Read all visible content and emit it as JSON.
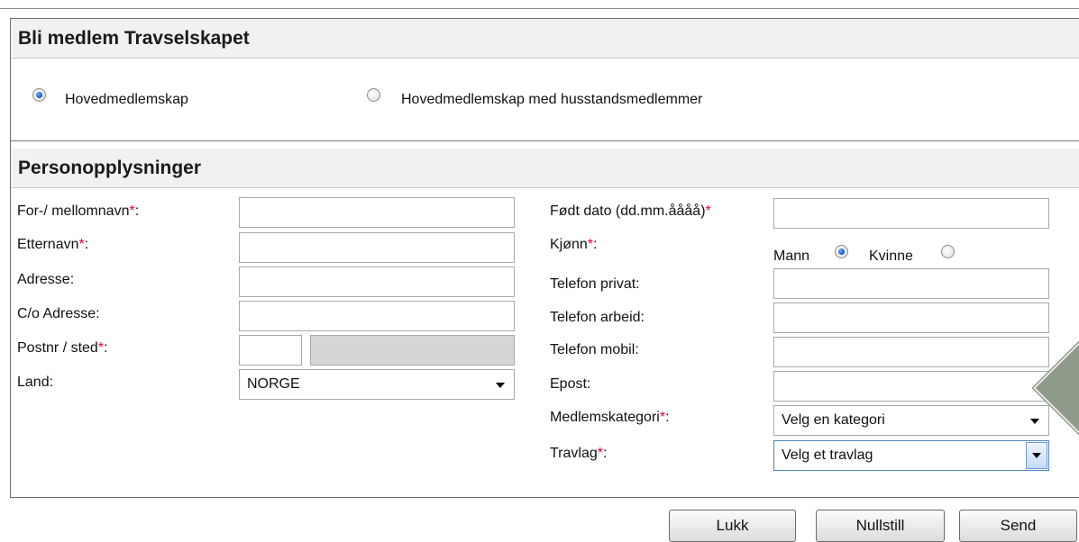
{
  "membership": {
    "title": "Bli medlem Travselskapet",
    "options": [
      {
        "label": "Hovedmedlemskap",
        "checked": true
      },
      {
        "label": "Hovedmedlemskap med husstandsmedlemmer",
        "checked": false
      }
    ]
  },
  "personal": {
    "title": "Personopplysninger",
    "required_mark": "*",
    "left_fields": [
      {
        "label": "For-/ mellomnavn",
        "required": true,
        "value": ""
      },
      {
        "label": "Etternavn",
        "required": true,
        "value": ""
      },
      {
        "label": "Adresse",
        "required": false,
        "value": ""
      },
      {
        "label": "C/o Adresse",
        "required": false,
        "value": ""
      },
      {
        "label": "Postnr / sted",
        "required": true,
        "postnr": "",
        "sted": ""
      },
      {
        "label": "Land",
        "required": false,
        "value": "NORGE"
      }
    ],
    "right_fields": [
      {
        "label": "Født dato (dd.mm.åååå)",
        "required": true,
        "value": ""
      },
      {
        "label": "Kjønn",
        "required": true
      },
      {
        "label": "Telefon privat",
        "required": false,
        "value": ""
      },
      {
        "label": "Telefon arbeid",
        "required": false,
        "value": ""
      },
      {
        "label": "Telefon mobil",
        "required": false,
        "value": ""
      },
      {
        "label": "Epost",
        "required": false,
        "value": ""
      },
      {
        "label": "Medlemskategori",
        "required": true,
        "value": "Velg en kategori"
      },
      {
        "label": "Travlag",
        "required": true,
        "value": "Velg et travlag"
      }
    ],
    "gender": {
      "male_label": "Mann",
      "male_checked": true,
      "female_label": "Kvinne",
      "female_checked": false
    },
    "colon": ":"
  },
  "buttons": {
    "close": "Lukk",
    "reset": "Nullstill",
    "send": "Send"
  },
  "colors": {
    "required": "#e0003c",
    "header_bg": "#f1f1f1",
    "radio_selected": "#1f5fc2"
  }
}
